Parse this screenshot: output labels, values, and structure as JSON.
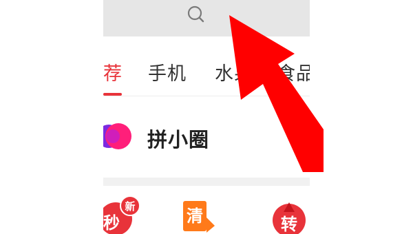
{
  "search": {
    "icon": "search-icon"
  },
  "tabs": [
    {
      "label": "荐",
      "active": true
    },
    {
      "label": "手机",
      "active": false
    },
    {
      "label": "水果",
      "active": false
    },
    {
      "label": "食品",
      "active": false
    }
  ],
  "circle": {
    "label": "拼小圈",
    "icon": "pinxiaoquan-logo"
  },
  "shortcuts": [
    {
      "text": "秒",
      "badge": "新",
      "icon": "flash-sale-icon"
    },
    {
      "text": "清",
      "icon": "clearance-icon"
    },
    {
      "text": "转",
      "icon": "spin-wheel-icon"
    }
  ],
  "colors": {
    "accent": "#e8333a",
    "search_bg": "#e6e6e6",
    "annotation_arrow": "#ff0000"
  }
}
